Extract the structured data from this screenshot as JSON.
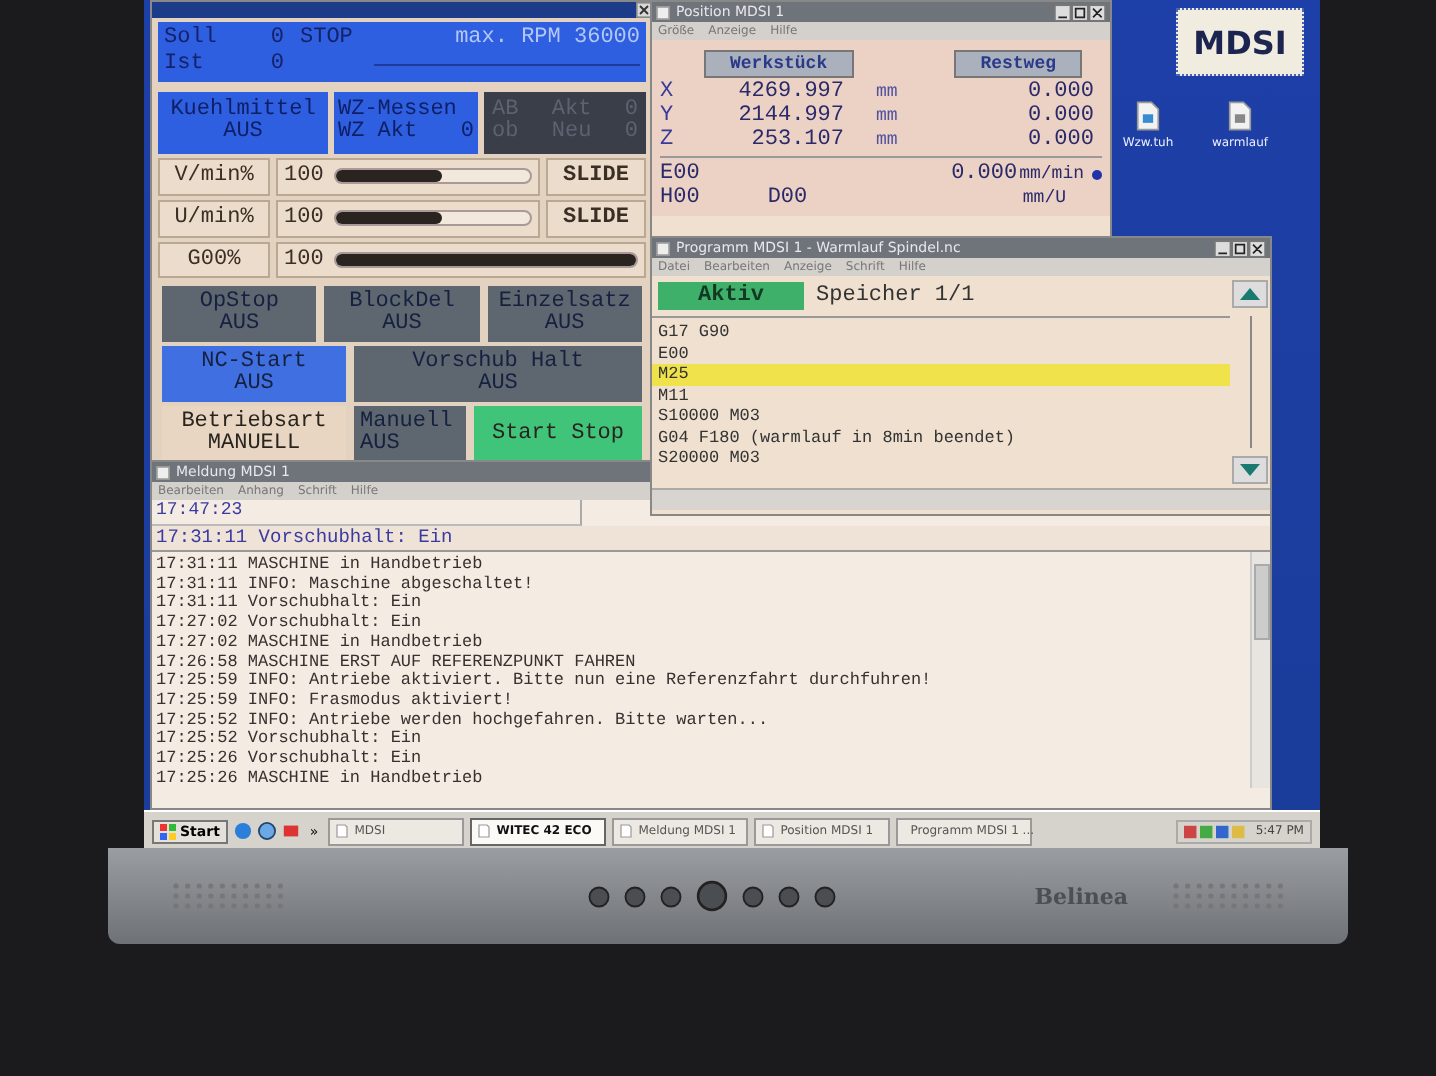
{
  "control_window": {
    "spindle": {
      "soll_label": "Soll",
      "soll_value": "0",
      "status": "STOP",
      "max": "max. RPM 36000",
      "ist_label": "Ist",
      "ist_value": "0"
    },
    "coolant": {
      "label": "Kuehlmittel",
      "state": "AUS"
    },
    "tool_measure": {
      "label": "WZ-Messen",
      "akt_label": "WZ Akt",
      "akt_value": "0"
    },
    "tool_counter": [
      {
        "col_1": "AB",
        "col_2": "Akt",
        "col_3": "0"
      },
      {
        "col_1": "ob",
        "col_2": "Neu",
        "col_3": "0"
      }
    ],
    "overrides": [
      {
        "label": "V/min%",
        "value": "100",
        "level": 0.55,
        "button": "SLIDE"
      },
      {
        "label": "U/min%",
        "value": "100",
        "level": 0.55,
        "button": "SLIDE"
      },
      {
        "label": "G00%",
        "value": "100",
        "level": 1.0
      }
    ],
    "button_rows": [
      [
        {
          "lines": [
            "OpStop",
            "AUS"
          ],
          "color": "#5e6670"
        },
        {
          "lines": [
            "BlockDel",
            "AUS"
          ],
          "color": "#5e6670"
        },
        {
          "lines": [
            "Einzelsatz",
            "AUS"
          ],
          "color": "#5e6670"
        }
      ],
      [
        {
          "lines": [
            "NC-Start",
            "AUS"
          ],
          "color": "#3f6fe0"
        },
        {
          "lines": [
            "Vorschub Halt",
            "AUS"
          ],
          "color": "#5e6670"
        }
      ],
      [
        {
          "lines": [
            "Betriebsart",
            "MANUELL"
          ],
          "color": "#e8d6c2"
        },
        {
          "lines": [
            "Manuell",
            "AUS"
          ],
          "color": "#5e6670"
        },
        {
          "lines": [
            "Start Stop"
          ],
          "color": "#3fc47a"
        }
      ]
    ]
  },
  "position_window": {
    "title": "Position MDSI 1",
    "menu": [
      "Größe",
      "Anzeige",
      "Hilfe"
    ],
    "headers": [
      "Werkstück",
      "Restweg"
    ],
    "axes": [
      {
        "axis": "X",
        "value": "4269.997",
        "unit": "mm",
        "rest": "0.000"
      },
      {
        "axis": "Y",
        "value": "2144.997",
        "unit": "mm",
        "rest": "0.000"
      },
      {
        "axis": "Z",
        "value": "253.107",
        "unit": "mm",
        "rest": "0.000"
      }
    ],
    "e_code": "E00",
    "feed": "0.000",
    "feed_unit": "mm/min",
    "h_code": "H00",
    "d_code": "D00",
    "feed_unit_2": "mm/U"
  },
  "desktop": {
    "logo": "MDSI",
    "icons": [
      {
        "label": "Wzw.tuh"
      },
      {
        "label": "warmlauf"
      }
    ]
  },
  "program_window": {
    "title": "Programm MDSI 1 - Warmlauf Spindel.nc",
    "menu": [
      "Datei",
      "Bearbeiten",
      "Anzeige",
      "Schrift",
      "Hilfe"
    ],
    "status": "Aktiv",
    "memory": "Speicher 1/1",
    "lines": [
      {
        "text": "G17 G90",
        "selected": false
      },
      {
        "text": "E00",
        "selected": false
      },
      {
        "text": "M25",
        "selected": true
      },
      {
        "text": "M11",
        "selected": false
      },
      {
        "text": "S10000 M03",
        "selected": false
      },
      {
        "text": "G04 F180 (warmlauf in 8min beendet)",
        "selected": false
      },
      {
        "text": "S20000 M03",
        "selected": false
      }
    ]
  },
  "message_window": {
    "title": "Meldung MDSI 1",
    "menu": [
      "Bearbeiten",
      "Anhang",
      "Schrift",
      "Hilfe"
    ],
    "time": "17:47:23",
    "current": "17:31:11 Vorschubhalt: Ein",
    "log": [
      "17:31:11 MASCHINE in Handbetrieb",
      "17:31:11 INFO: Maschine abgeschaltet!",
      "17:31:11 Vorschubhalt: Ein",
      "17:27:02 Vorschubhalt: Ein",
      "17:27:02 MASCHINE in Handbetrieb",
      "17:26:58 MASCHINE ERST AUF REFERENZPUNKT FAHREN",
      "17:25:59 INFO: Antriebe aktiviert. Bitte nun eine Referenzfahrt durchfuhren!",
      "17:25:59 INFO: Frasmodus aktiviert!",
      "17:25:52 INFO: Antriebe werden hochgefahren. Bitte warten...",
      "17:25:52 Vorschubhalt: Ein",
      "17:25:26 Vorschubhalt: Ein",
      "17:25:26 MASCHINE in Handbetrieb"
    ]
  },
  "taskbar": {
    "start": "Start",
    "more": "»",
    "tasks": [
      {
        "label": "MDSI",
        "selected": false
      },
      {
        "label": "WITEC 42 ECO",
        "selected": true
      },
      {
        "label": "Meldung MDSI 1",
        "selected": false
      },
      {
        "label": "Position MDSI 1",
        "selected": false
      },
      {
        "label": "Programm MDSI 1 ...",
        "selected": false
      }
    ],
    "clock": "5:47 PM"
  },
  "monitor": {
    "brand": "Belinea"
  }
}
